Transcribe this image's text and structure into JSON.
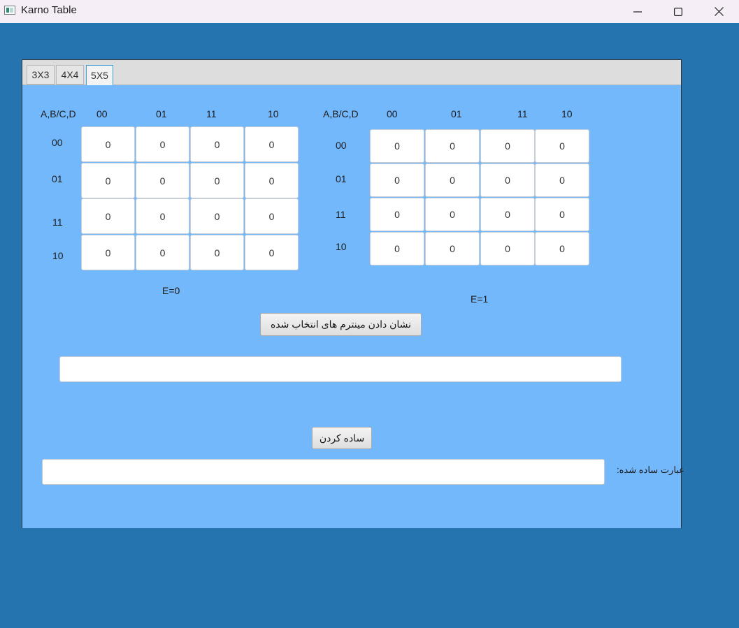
{
  "window": {
    "title": "Karno Table"
  },
  "tabs": [
    {
      "label": "3X3"
    },
    {
      "label": "4X4"
    },
    {
      "label": "5X5"
    }
  ],
  "map_left": {
    "corner_label": "A,B/C,D",
    "col_headers": [
      "00",
      "01",
      "11",
      "10"
    ],
    "row_headers": [
      "00",
      "01",
      "11",
      "10"
    ],
    "cells": [
      [
        "0",
        "0",
        "0",
        "0"
      ],
      [
        "0",
        "0",
        "0",
        "0"
      ],
      [
        "0",
        "0",
        "0",
        "0"
      ],
      [
        "0",
        "0",
        "0",
        "0"
      ]
    ],
    "caption": "E=0"
  },
  "map_right": {
    "corner_label": "A,B/C,D",
    "col_headers": [
      "00",
      "01",
      "11",
      "10"
    ],
    "row_headers": [
      "00",
      "01",
      "11",
      "10"
    ],
    "cells": [
      [
        "0",
        "0",
        "0",
        "0"
      ],
      [
        "0",
        "0",
        "0",
        "0"
      ],
      [
        "0",
        "0",
        "0",
        "0"
      ],
      [
        "0",
        "0",
        "0",
        "0"
      ]
    ],
    "caption": "E=1"
  },
  "actions": {
    "show_minterms_label": "نشان دادن مینترم های انتخاب شده",
    "simplify_label": "ساده کردن"
  },
  "minterms_field": {
    "value": ""
  },
  "simplified": {
    "label": "عبارت ساده شده:",
    "value": ""
  }
}
